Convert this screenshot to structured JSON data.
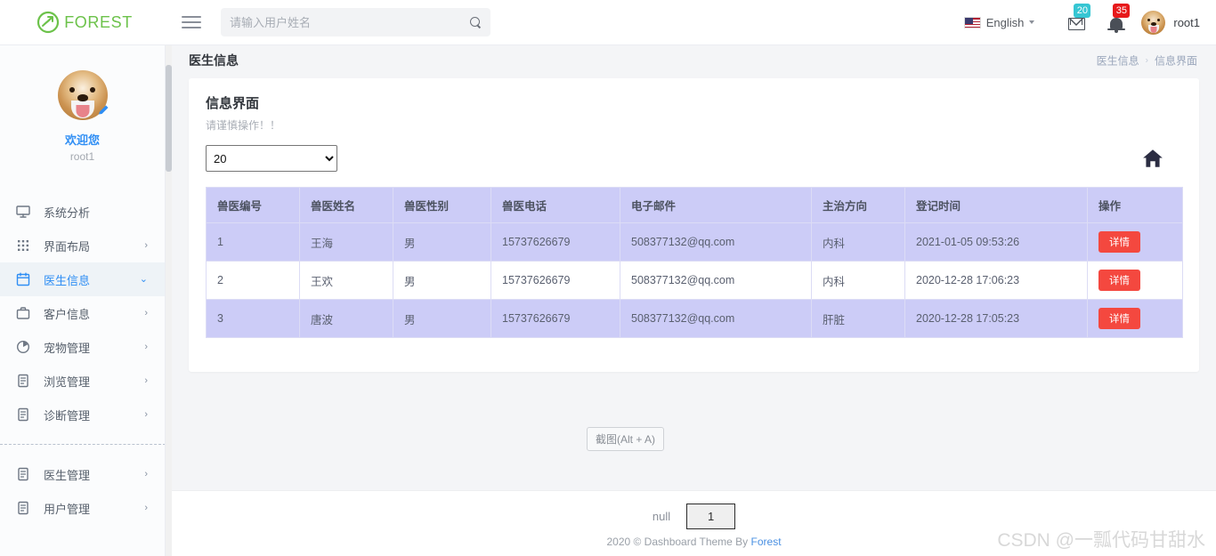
{
  "topbar": {
    "logo_text": "FOREST",
    "logo_icon": "forest-leaf-logo",
    "menu_icon": "hamburger-icon",
    "search": {
      "placeholder": "请输入用户姓名",
      "value": "",
      "icon": "search-icon"
    },
    "language": {
      "label": "English",
      "flag": "us-flag-icon",
      "caret": "chevron-down-icon"
    },
    "messages": {
      "icon": "envelope-icon",
      "badge": "20",
      "badge_color": "#36c6d3"
    },
    "notifications": {
      "icon": "bell-icon",
      "badge": "35",
      "badge_color": "#e7191b"
    },
    "user": {
      "name": "root1",
      "avatar": "dog-avatar"
    }
  },
  "sidebar": {
    "profile": {
      "avatar": "dog-avatar",
      "edit_icon": "pencil-icon",
      "welcome": "欢迎您",
      "username": "root1"
    },
    "items": [
      {
        "label": "系统分析",
        "icon": "monitor-icon",
        "arrow": "",
        "active": false
      },
      {
        "label": "界面布局",
        "icon": "grid-dots-icon",
        "arrow": "›",
        "active": false
      },
      {
        "label": "医生信息",
        "icon": "calendar-icon",
        "arrow": "⌄",
        "active": true
      },
      {
        "label": "客户信息",
        "icon": "briefcase-icon",
        "arrow": "›",
        "active": false
      },
      {
        "label": "宠物管理",
        "icon": "pie-chart-icon",
        "arrow": "›",
        "active": false
      },
      {
        "label": "浏览管理",
        "icon": "document-icon",
        "arrow": "›",
        "active": false
      },
      {
        "label": "诊断管理",
        "icon": "document-icon",
        "arrow": "›",
        "active": false
      }
    ],
    "items_after_divider": [
      {
        "label": "医生管理",
        "icon": "document-icon",
        "arrow": "›",
        "active": false
      },
      {
        "label": "用户管理",
        "icon": "document-icon",
        "arrow": "›",
        "active": false
      }
    ]
  },
  "page": {
    "title": "医生信息",
    "breadcrumb": {
      "parent": "医生信息",
      "separator": "›",
      "current": "信息界面"
    }
  },
  "card": {
    "title": "信息界面",
    "subtitle": "请谨慎操作！！",
    "rows_per_page": {
      "value": "20",
      "options": [
        "20"
      ]
    },
    "home_icon": "home-icon"
  },
  "table": {
    "columns": [
      "兽医编号",
      "兽医姓名",
      "兽医性别",
      "兽医电话",
      "电子邮件",
      "主治方向",
      "登记时间",
      "操作"
    ],
    "rows": [
      {
        "id": "1",
        "name": "王海",
        "gender": "男",
        "phone": "15737626679",
        "email": "508377132@qq.com",
        "specialty": "内科",
        "registered": "2021-01-05 09:53:26",
        "action": "详情"
      },
      {
        "id": "2",
        "name": "王欢",
        "gender": "男",
        "phone": "15737626679",
        "email": "508377132@qq.com",
        "specialty": "内科",
        "registered": "2020-12-28 17:06:23",
        "action": "详情"
      },
      {
        "id": "3",
        "name": "唐波",
        "gender": "男",
        "phone": "15737626679",
        "email": "508377132@qq.com",
        "specialty": "肝脏",
        "registered": "2020-12-28 17:05:23",
        "action": "详情"
      }
    ]
  },
  "snip_tooltip": "截图(Alt + A)",
  "footer": {
    "pager_label": "null",
    "current_page": "1",
    "copyright_prefix": "2020 © Dashboard Theme By ",
    "copyright_link": "Forest"
  },
  "watermark": "CSDN @一瓢代码甘甜水",
  "colors": {
    "brand_green": "#6cc24a",
    "accent_blue": "#2f8ef4",
    "table_row_shade": "#ccccf7",
    "detail_button": "#f4483f",
    "badge_blue": "#36c6d3",
    "badge_red": "#e7191b"
  }
}
